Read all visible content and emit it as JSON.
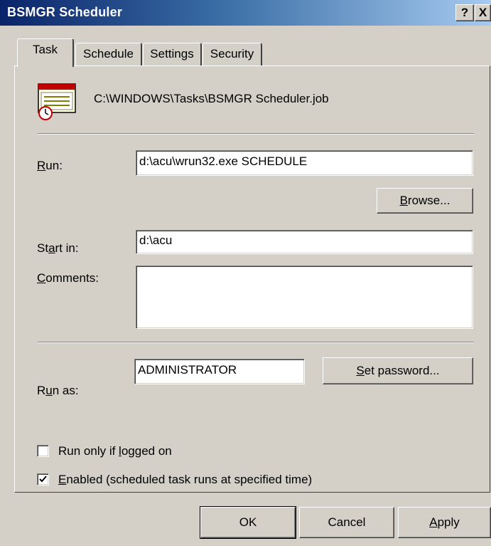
{
  "window": {
    "title": "BSMGR Scheduler",
    "help_glyph": "?",
    "close_glyph": "X"
  },
  "tabs": [
    {
      "label": "Task",
      "active": true
    },
    {
      "label": "Schedule",
      "active": false
    },
    {
      "label": "Settings",
      "active": false
    },
    {
      "label": "Security",
      "active": false
    }
  ],
  "task": {
    "icon": "scheduled-task-icon",
    "job_path": "C:\\WINDOWS\\Tasks\\BSMGR Scheduler.job",
    "run": {
      "label_pre": "",
      "label_key": "R",
      "label_post": "un:",
      "value": "d:\\acu\\wrun32.exe SCHEDULE"
    },
    "browse": {
      "label_pre": "",
      "label_key": "B",
      "label_post": "rowse..."
    },
    "start_in": {
      "label_pre": "St",
      "label_key": "a",
      "label_post": "rt in:",
      "value": "d:\\acu"
    },
    "comments": {
      "label_pre": "",
      "label_key": "C",
      "label_post": "omments:",
      "value": ""
    },
    "run_as": {
      "label_pre": "R",
      "label_key": "u",
      "label_post": "n as:",
      "value": "ADMINISTRATOR"
    },
    "set_password": {
      "label_pre": "",
      "label_key": "S",
      "label_post": "et password..."
    },
    "run_only_logged_on": {
      "label_pre": "Run only if ",
      "label_key": "l",
      "label_post": "ogged on",
      "checked": false
    },
    "enabled": {
      "label_pre": "",
      "label_key": "E",
      "label_post": "nabled (scheduled task runs at specified time)",
      "checked": true
    }
  },
  "buttons": {
    "ok": "OK",
    "cancel": "Cancel",
    "apply_pre": "",
    "apply_key": "A",
    "apply_post": "pply"
  },
  "colors": {
    "titlebar_start": "#0a246a",
    "titlebar_end": "#a6caf0",
    "face": "#d4d0c8"
  }
}
